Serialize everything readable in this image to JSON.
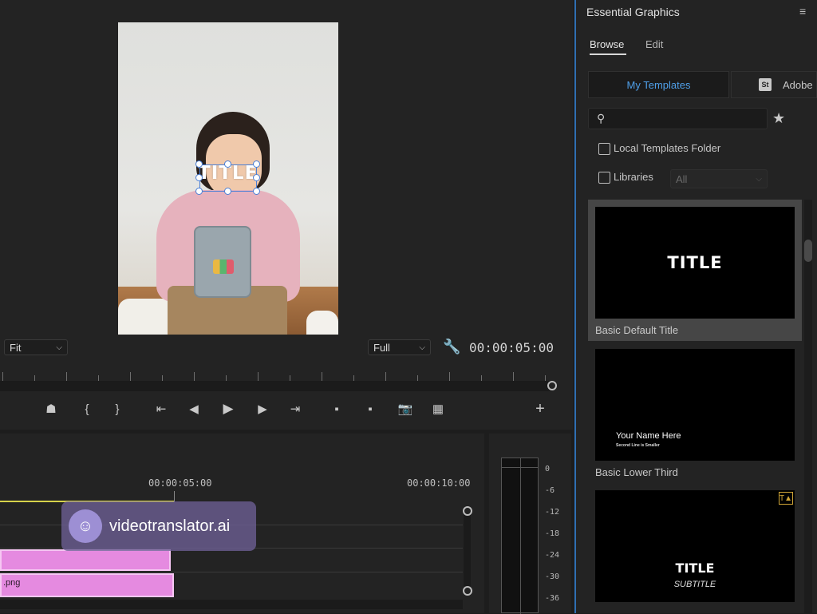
{
  "program_monitor": {
    "overlay_title": "TITLE",
    "fit_dropdown": "Fit",
    "quality_dropdown": "Full",
    "timecode": "00:00:05:00"
  },
  "timeline": {
    "timestamps": [
      "00:00:05:00",
      "00:00:10:00"
    ],
    "clip_label": ".png"
  },
  "watermark": {
    "text": "videotranslator.ai"
  },
  "audio_meter": {
    "labels": [
      "0",
      "-6",
      "-12",
      "-18",
      "-24",
      "-30",
      "-36"
    ]
  },
  "essential_graphics": {
    "title": "Essential Graphics",
    "tabs": [
      "Browse",
      "Edit"
    ],
    "active_tab": "Browse",
    "source_tabs": [
      "My Templates",
      "Adobe"
    ],
    "stock_badge": "St",
    "search_placeholder": "",
    "local_templates_label": "Local Templates Folder",
    "libraries_label": "Libraries",
    "libraries_select": "All",
    "templates": [
      {
        "name": "Basic Default Title",
        "thumb_title": "TITLE"
      },
      {
        "name": "Basic Lower Third",
        "thumb_line1": "Your Name Here",
        "thumb_line2": "Second Line is Smaller"
      },
      {
        "name": "",
        "thumb_title": "TITLE",
        "thumb_subtitle": "SUBTITLE"
      }
    ]
  },
  "colors": {
    "accent": "#2f6fb3",
    "clip": "#e58ae0",
    "playhead": "#d6d24a"
  }
}
